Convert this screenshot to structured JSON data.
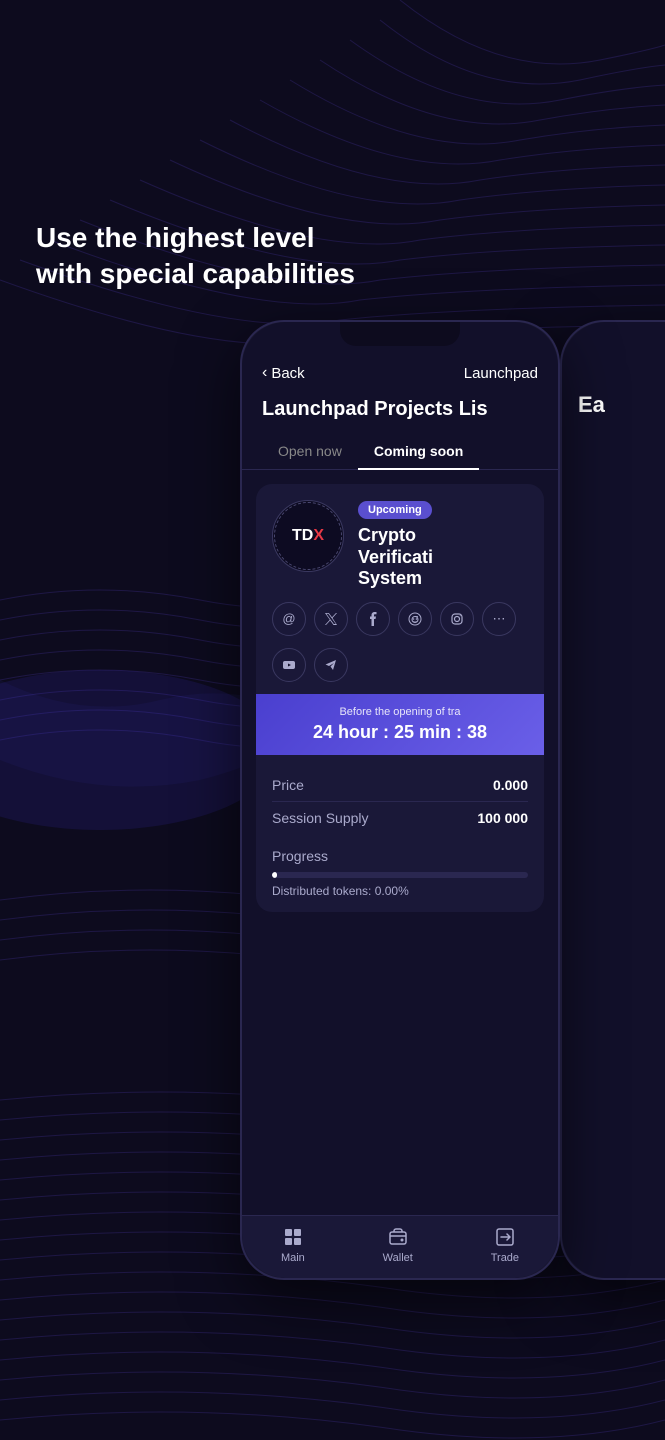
{
  "background": {
    "color": "#0d0b1e"
  },
  "headline": {
    "text": "Use the highest level with special capabilities"
  },
  "phone": {
    "nav": {
      "back_label": "Back",
      "title": "Launchpad"
    },
    "page_title": "Launchpad Projects Lis",
    "tabs": [
      {
        "label": "Open now",
        "active": false
      },
      {
        "label": "Coming soon",
        "active": true
      }
    ],
    "project": {
      "badge": "Upcoming",
      "logo_text": "TDX",
      "name_line1": "Crypto",
      "name_line2": "Verificati",
      "name_line3": "System"
    },
    "social_icons": [
      {
        "name": "at-icon",
        "symbol": "@"
      },
      {
        "name": "twitter-icon",
        "symbol": "𝕏"
      },
      {
        "name": "facebook-icon",
        "symbol": "f"
      },
      {
        "name": "reddit-icon",
        "symbol": "r"
      },
      {
        "name": "instagram-icon",
        "symbol": "◎"
      },
      {
        "name": "more-icon",
        "symbol": "⋯"
      },
      {
        "name": "youtube-icon",
        "symbol": "▶"
      },
      {
        "name": "telegram-icon",
        "symbol": "✈"
      }
    ],
    "countdown": {
      "label": "Before the opening of tra",
      "time": "24 hour : 25 min : 38"
    },
    "stats": [
      {
        "label": "Price",
        "value": "0.000"
      },
      {
        "label": "Session Supply",
        "value": "100 000"
      }
    ],
    "progress": {
      "label": "Progress",
      "bar_percent": 2,
      "distributed_text": "Distributed tokens: 0.00%"
    },
    "bottom_nav": [
      {
        "name": "main-nav",
        "icon": "grid-icon",
        "label": "Main"
      },
      {
        "name": "wallet-nav",
        "icon": "wallet-icon",
        "label": "Wallet"
      },
      {
        "name": "trade-nav",
        "icon": "trade-icon",
        "label": "Trade"
      }
    ]
  },
  "phone2": {
    "partial_text": "Ea"
  }
}
